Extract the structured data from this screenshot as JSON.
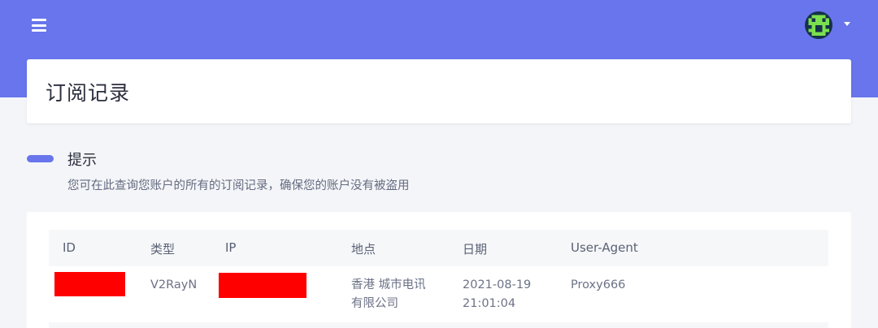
{
  "header": {
    "background_color": "#6875ec",
    "menu_icon": "hamburger-menu-icon",
    "avatar_icon": "user-avatar-icon",
    "dropdown_icon": "caret-down-icon"
  },
  "page": {
    "title": "订阅记录"
  },
  "tip": {
    "title": "提示",
    "text": "您可在此查询您账户的所有的订阅记录，确保您的账户没有被盗用"
  },
  "table": {
    "columns": [
      "ID",
      "类型",
      "IP",
      "地点",
      "日期",
      "User-Agent"
    ],
    "rows": [
      {
        "id": "",
        "type": "V2RayN",
        "ip": "",
        "location_line1": "香港 城市电讯",
        "location_line2": "有限公司",
        "date_line1": "2021-08-19",
        "date_line2": "21:01:04",
        "user_agent": "Proxy666"
      }
    ]
  }
}
